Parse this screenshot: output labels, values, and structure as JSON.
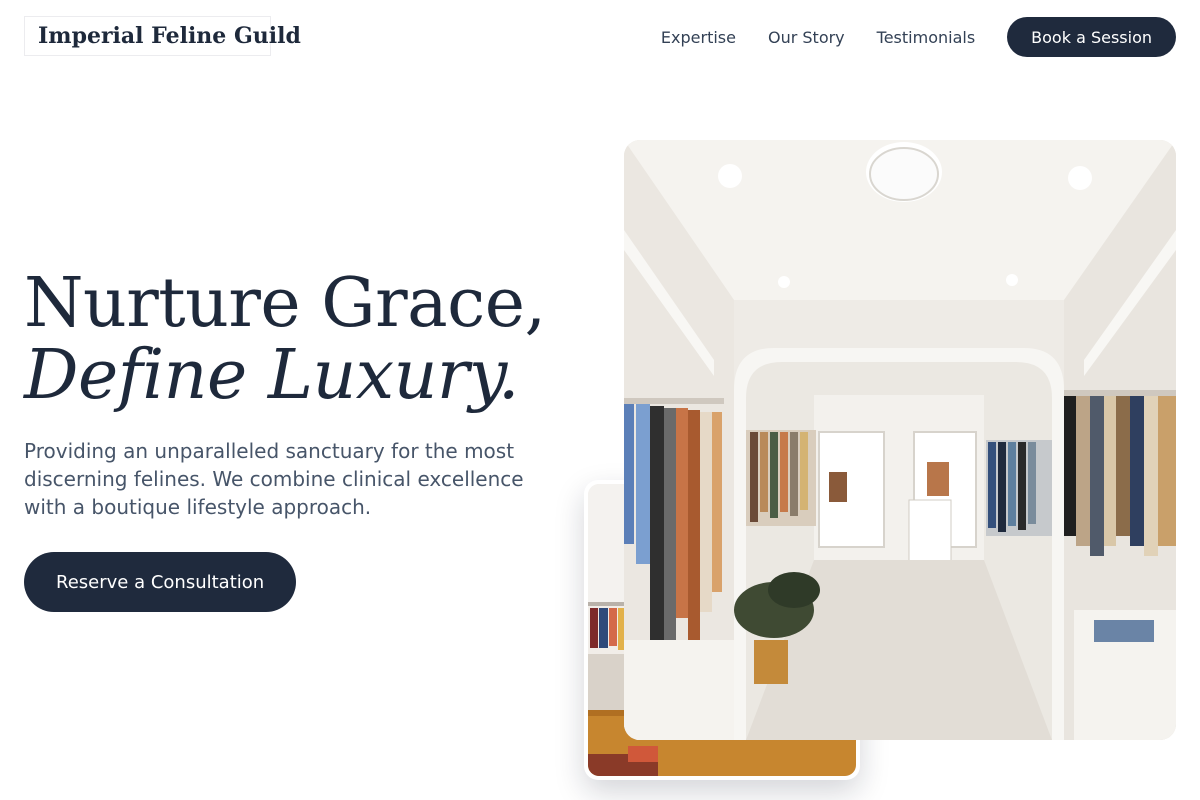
{
  "brand": {
    "name": "Imperial Feline Guild"
  },
  "nav": {
    "links": [
      "Expertise",
      "Our Story",
      "Testimonials"
    ],
    "cta_label": "Book a Session"
  },
  "hero": {
    "title_line1": "Nurture Grace,",
    "title_line2": "Define Luxury.",
    "subtitle": "Providing an unparalleled sanctuary for the most discerning felines. We combine clinical excellence with a boutique lifestyle approach.",
    "cta_label": "Reserve a Consultation"
  },
  "colors": {
    "primary": "#1f2a3d",
    "text": "#1e293b",
    "muted": "#475569",
    "background": "#ffffff"
  }
}
